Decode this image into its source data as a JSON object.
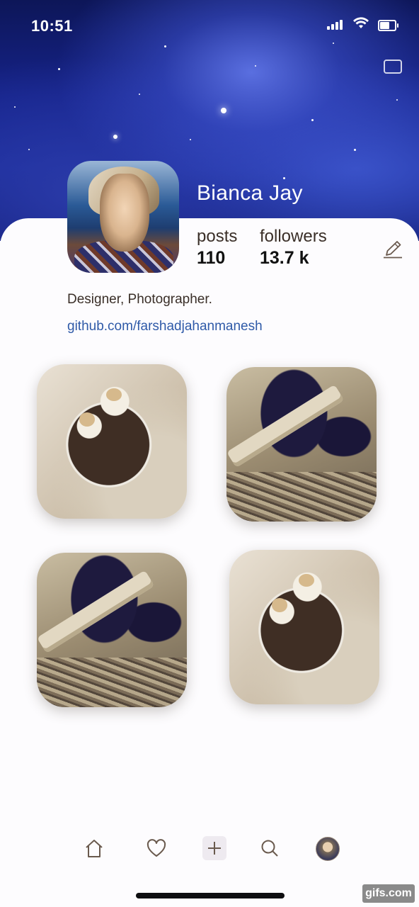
{
  "status_bar": {
    "time": "10:51"
  },
  "profile": {
    "name": "Bianca Jay",
    "stats": [
      {
        "label": "posts",
        "value": "110"
      },
      {
        "label": "followers",
        "value": "13.7 k"
      }
    ],
    "bio": "Designer, Photographer.",
    "link": "github.com/farshadjahanmanesh"
  },
  "posts": [
    {
      "subject": "food-bowl-photo"
    },
    {
      "subject": "dog-stick-photo"
    },
    {
      "subject": "dog-stick-photo"
    },
    {
      "subject": "food-bowl-photo"
    }
  ],
  "bottom_nav": {
    "items": [
      "home-icon",
      "heart-icon",
      "plus-icon",
      "search-icon",
      "profile-avatar"
    ]
  },
  "watermark": "gifs.com",
  "colors": {
    "link": "#2f5aa8",
    "text": "#3a2f28"
  }
}
